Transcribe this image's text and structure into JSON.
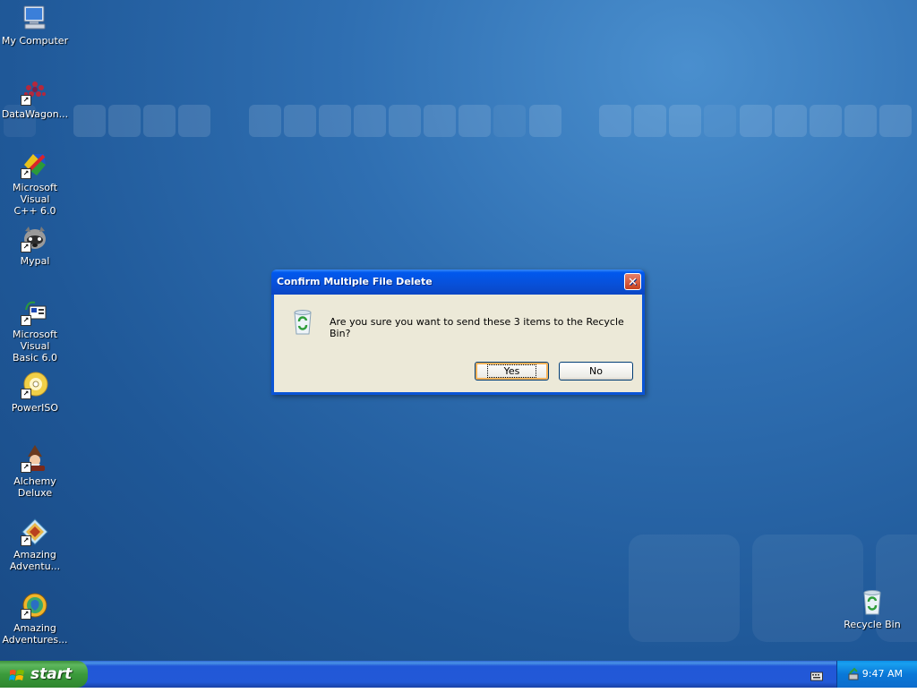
{
  "desktop": {
    "icons": [
      {
        "label": "My Computer",
        "icon": "my-computer-icon",
        "shortcut": false
      },
      {
        "label": "DataWagon...",
        "icon": "datawagon-icon",
        "shortcut": true
      },
      {
        "label": "Microsoft Visual\nC++ 6.0",
        "icon": "visual-cpp-icon",
        "shortcut": true
      },
      {
        "label": "Mypal",
        "icon": "mypal-icon",
        "shortcut": true
      },
      {
        "label": "Microsoft Visual\nBasic 6.0",
        "icon": "visual-basic-icon",
        "shortcut": true
      },
      {
        "label": "PowerISO",
        "icon": "poweriso-icon",
        "shortcut": true
      },
      {
        "label": "Alchemy\nDeluxe",
        "icon": "alchemy-icon",
        "shortcut": true
      },
      {
        "label": "Amazing\nAdventu...",
        "icon": "amazing-adventures-icon",
        "shortcut": true
      },
      {
        "label": "Amazing\nAdventures...",
        "icon": "amazing-adventures-2-icon",
        "shortcut": true
      },
      {
        "label": "Recycle Bin",
        "icon": "recycle-bin-icon",
        "shortcut": false
      }
    ]
  },
  "dialog": {
    "title": "Confirm Multiple File Delete",
    "message": "Are you sure you want to send these 3 items to the Recycle Bin?",
    "yes_label": "Yes",
    "no_label": "No",
    "icon": "recycle-bin-icon"
  },
  "taskbar": {
    "start_label": "start",
    "clock": "9:47 AM"
  },
  "colors": {
    "desktop_blue": "#2f6fb2",
    "title_blue": "#0058ee",
    "start_green": "#3b9b3b",
    "close_red": "#c8401e",
    "dialog_face": "#ece9d8"
  }
}
